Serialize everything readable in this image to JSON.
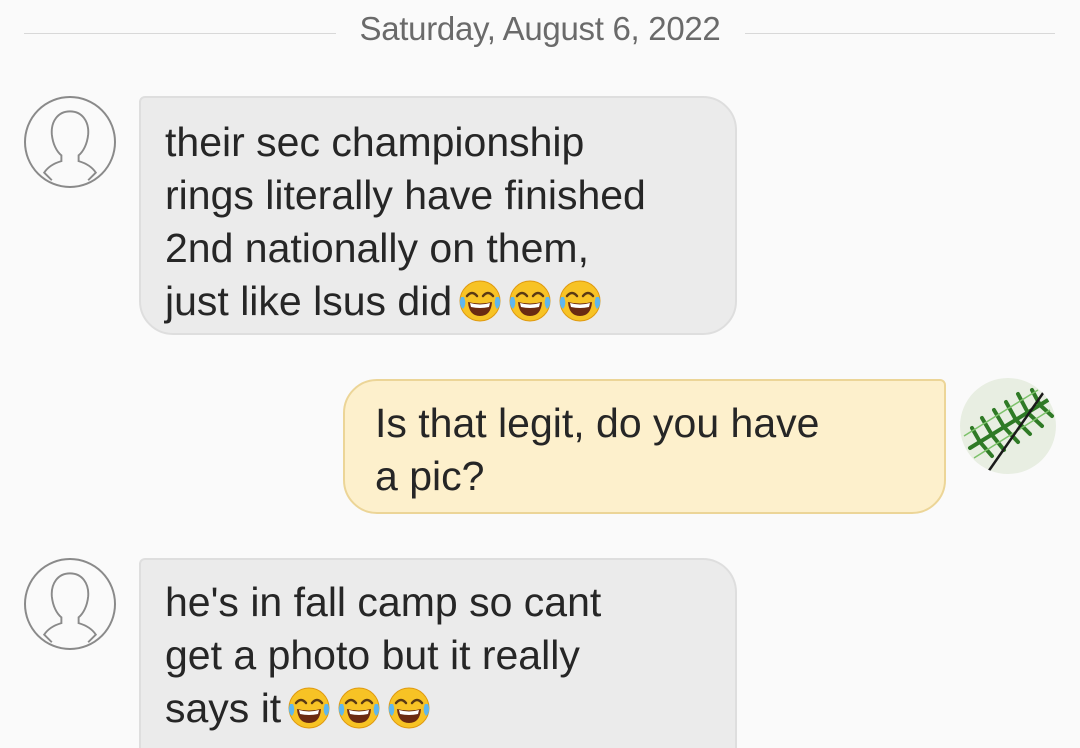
{
  "conversation": {
    "date_label": "Saturday, August 6, 2022",
    "messages": [
      {
        "direction": "incoming",
        "lines": [
          "their sec championship",
          "rings literally have finished",
          "2nd nationally on them,",
          "just like lsus did"
        ],
        "emoji": [
          "face-with-tears-of-joy",
          "face-with-tears-of-joy",
          "face-with-tears-of-joy"
        ]
      },
      {
        "direction": "outgoing",
        "lines": [
          "Is that legit, do you have",
          "a pic?"
        ]
      },
      {
        "direction": "incoming",
        "lines": [
          "he's in fall camp so cant",
          "get a photo but it really",
          "says it"
        ],
        "emoji": [
          "face-with-tears-of-joy",
          "face-with-tears-of-joy",
          "face-with-tears-of-joy"
        ]
      }
    ]
  },
  "colors": {
    "incoming_bubble": "#ebebeb",
    "outgoing_bubble": "#fdf0cc",
    "outgoing_border": "#ecd597",
    "text": "#262626",
    "date_text": "#6a6a6a"
  },
  "icons": {
    "contact_avatar": "default-person-icon",
    "own_avatar": "fern-leaf-photo",
    "emoji": "face-with-tears-of-joy"
  }
}
